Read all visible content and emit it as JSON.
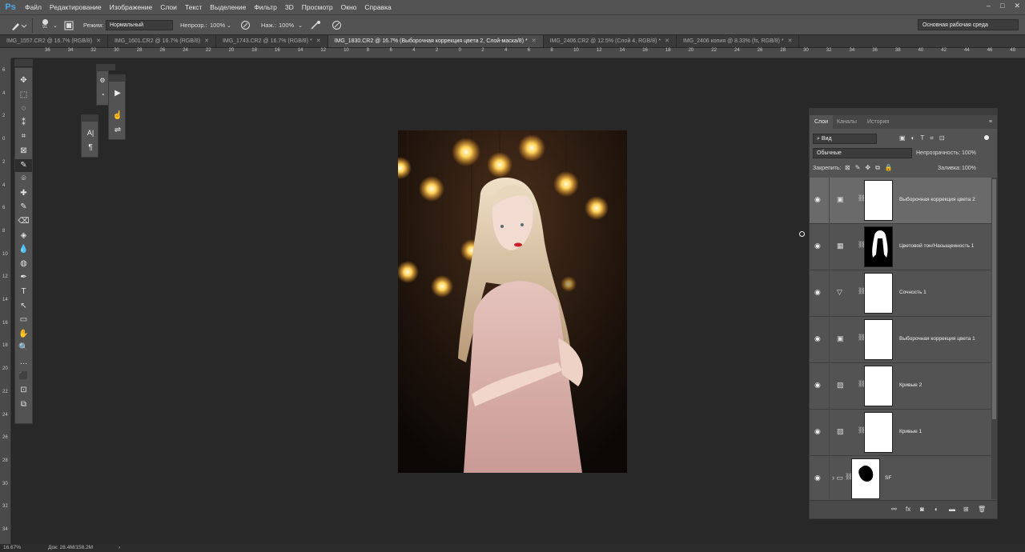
{
  "app": {
    "logo": "Ps"
  },
  "menu": [
    "Файл",
    "Редактирование",
    "Изображение",
    "Слои",
    "Текст",
    "Выделение",
    "Фильтр",
    "3D",
    "Просмотр",
    "Окно",
    "Справка"
  ],
  "window_controls": [
    "–",
    "□",
    "✕"
  ],
  "options": {
    "brush_size": "91",
    "mode_label": "Режим:",
    "mode_value": "Нормальный",
    "opacity_label": "Непрозр.:",
    "opacity_value": "100%",
    "pressure_label": "Наж.:",
    "pressure_value": "100%",
    "workspace": "Основная рабочая среда"
  },
  "tabs": [
    {
      "label": "IMG_1557.CR2 @ 16.7% (RGB/8)",
      "active": false
    },
    {
      "label": "IMG_1601.CR2 @ 16.7% (RGB/8)",
      "active": false
    },
    {
      "label": "IMG_1743.CR2 @ 16.7% (RGB/8) *",
      "active": false
    },
    {
      "label": "IMG_1830.CR2 @ 16.7% (Выборочная коррекция цвета 2, Слой-маска/8) *",
      "active": true
    },
    {
      "label": "IMG_2406.CR2 @ 12.5% (Слой 4, RGB/8) *",
      "active": false
    },
    {
      "label": "IMG_2406 копия @ 8.33% (fs, RGB/8) *",
      "active": false
    }
  ],
  "tab_close": "✕",
  "ruler_h_ticks": [
    "36",
    "34",
    "32",
    "30",
    "28",
    "26",
    "24",
    "22",
    "20",
    "18",
    "16",
    "14",
    "12",
    "10",
    "8",
    "6",
    "4",
    "2",
    "0",
    "2",
    "4",
    "6",
    "8",
    "10",
    "12",
    "14",
    "16",
    "18",
    "20",
    "22",
    "24",
    "26",
    "28",
    "30",
    "32",
    "34",
    "36",
    "38",
    "40",
    "42",
    "44",
    "46",
    "48",
    "50"
  ],
  "ruler_v_ticks": [
    "6",
    "4",
    "2",
    "0",
    "2",
    "4",
    "6",
    "8",
    "10",
    "12",
    "14",
    "16",
    "18",
    "20",
    "22",
    "24",
    "26",
    "28",
    "30",
    "32",
    "34"
  ],
  "tools": [
    "✥",
    "⬚",
    "◌",
    "⁑",
    "⌗",
    "⊠",
    "✎",
    "⌾",
    "✚",
    "✎",
    "⌫",
    "◈",
    "💧",
    "◍",
    "✒",
    "T",
    "↖",
    "▭",
    "✋",
    "🔍",
    "…",
    "⬛",
    "⊡",
    "⧉"
  ],
  "mini_panels": {
    "play_icon": "▶",
    "char_icon": "A|",
    "para_icon": "¶",
    "hand_icon": "☝",
    "adjust_icon": "⇌"
  },
  "layers_panel": {
    "tabs": [
      "Слои",
      "Каналы",
      "История"
    ],
    "search_value": "Вид",
    "blend_mode": "Обычные",
    "opacity_label": "Непрозрачность:",
    "opacity_value": "100%",
    "lock_label": "Закрепить:",
    "fill_label": "Заливка:",
    "fill_value": "100%",
    "layers": [
      {
        "name": "Выборочная коррекция цвета 2",
        "icon": "▣",
        "selected": true,
        "mask": "white"
      },
      {
        "name": "Цветовой тон/Насыщенность 1",
        "icon": "▦",
        "selected": false,
        "mask": "hair"
      },
      {
        "name": "Сочность 1",
        "icon": "▽",
        "selected": false,
        "mask": "white"
      },
      {
        "name": "Выборочная коррекция цвета 1",
        "icon": "▣",
        "selected": false,
        "mask": "white"
      },
      {
        "name": "Кривые 2",
        "icon": "▨",
        "selected": false,
        "mask": "white"
      },
      {
        "name": "Кривые 1",
        "icon": "▨",
        "selected": false,
        "mask": "white"
      },
      {
        "name": "SF",
        "icon": "▭",
        "selected": false,
        "mask": "blob"
      }
    ],
    "footer_icons": [
      "⚯",
      "fx",
      "◙",
      "◐",
      "▬",
      "⊞",
      "🗑"
    ]
  },
  "status": {
    "zoom": "16.67%",
    "doc": "Док: 28.4M/158.2M",
    "arrow": "›"
  }
}
